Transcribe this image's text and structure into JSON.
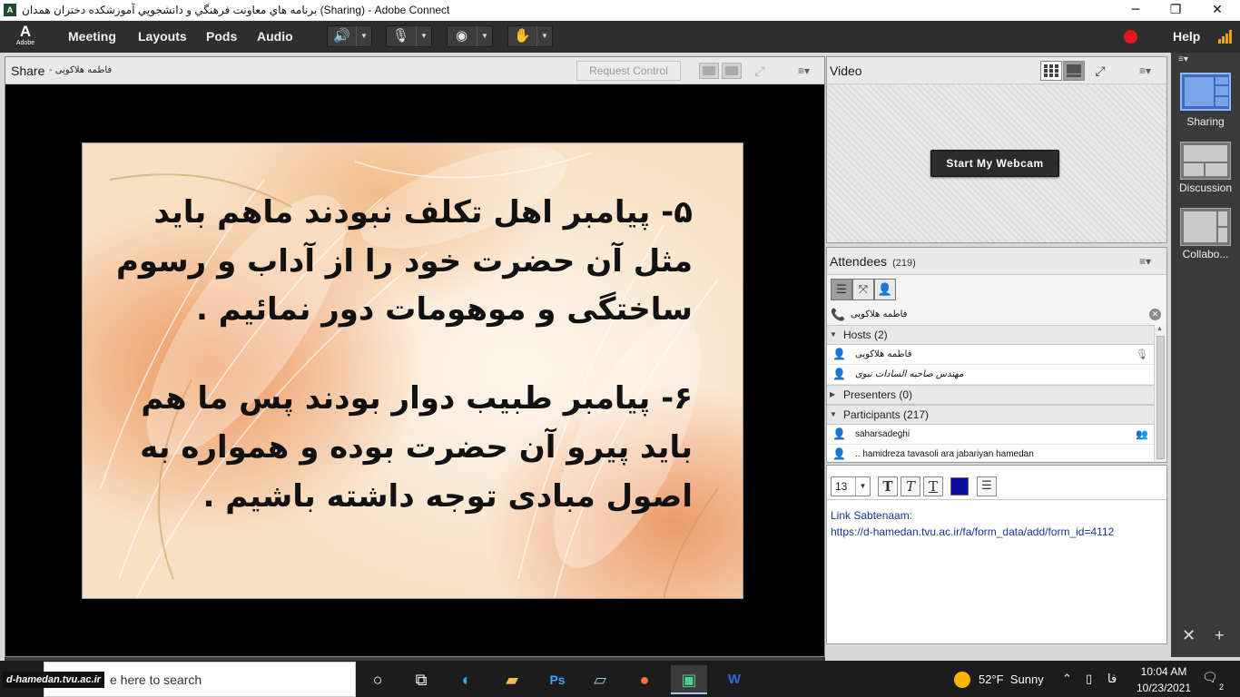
{
  "window": {
    "title": "برنامه هاي معاونت فرهنگي و دانشجويي آموزشكده دختران همدان (Sharing) - Adobe Connect",
    "minimize": "─",
    "maximize": "❐",
    "close": "✕"
  },
  "menubar": {
    "logo_letter": "A",
    "logo_text": "Adobe",
    "items": [
      "Meeting",
      "Layouts",
      "Pods",
      "Audio"
    ],
    "help": "Help",
    "icons": {
      "speaker": "speaker-icon",
      "mic": "microphone-icon",
      "webcam": "webcam-icon",
      "raise_hand": "raise-hand-icon"
    },
    "recording_color": "#e8161d"
  },
  "share_pod": {
    "title": "Share",
    "presenter": "- فاطمه هلاکویی",
    "request_control": "Request Control",
    "slide": {
      "paragraphs": [
        "۵- پیامبر اهل تکلف نبودند ماهم باید مثل آن حضرت خود را از آداب و رسوم ساختگی و موهومات دور نمائیم .",
        "۶- پیامبر طبیب دوار بودند پس ما هم باید پیرو آن حضرت بوده و همواره به اصول مبادی توجه داشته باشیم ."
      ]
    }
  },
  "video_pod": {
    "title": "Video",
    "start_webcam": "Start My Webcam"
  },
  "attendees_pod": {
    "title": "Attendees",
    "count": "(219)",
    "current_user": "فاطمه هلاکویی",
    "groups": {
      "hosts": "Hosts (2)",
      "presenters": "Presenters (0)",
      "participants": "Participants (217)"
    },
    "hosts": [
      "فاطمه هلاکویی",
      "مهندس صاحبه السادات نبوی"
    ],
    "participants": [
      "saharsadeghi",
      ".. hamidreza tavasoli ara jabariyan hamedan"
    ]
  },
  "chat_pod": {
    "font_size": "13",
    "bold": "T",
    "italic": "T",
    "underline": "T",
    "text_color": "#0b0b9c",
    "message_line1": "Link Sabtenaam:",
    "message_line2": "https://d-hamedan.tvu.ac.ir/fa/form_data/add/form_id=4112"
  },
  "layouts": {
    "items": [
      "Sharing",
      "Discussion",
      "Collabo..."
    ],
    "selected": "Sharing"
  },
  "taskbar": {
    "watermark": "d-hamedan.tvu.ac.ir",
    "search_placeholder": "Type here to search",
    "search_visible": "e here to search",
    "weather_temp": "52°F",
    "weather_desc": "Sunny",
    "lang": "فا",
    "time": "10:04 AM",
    "date": "10/23/2021",
    "notifications": "2"
  }
}
